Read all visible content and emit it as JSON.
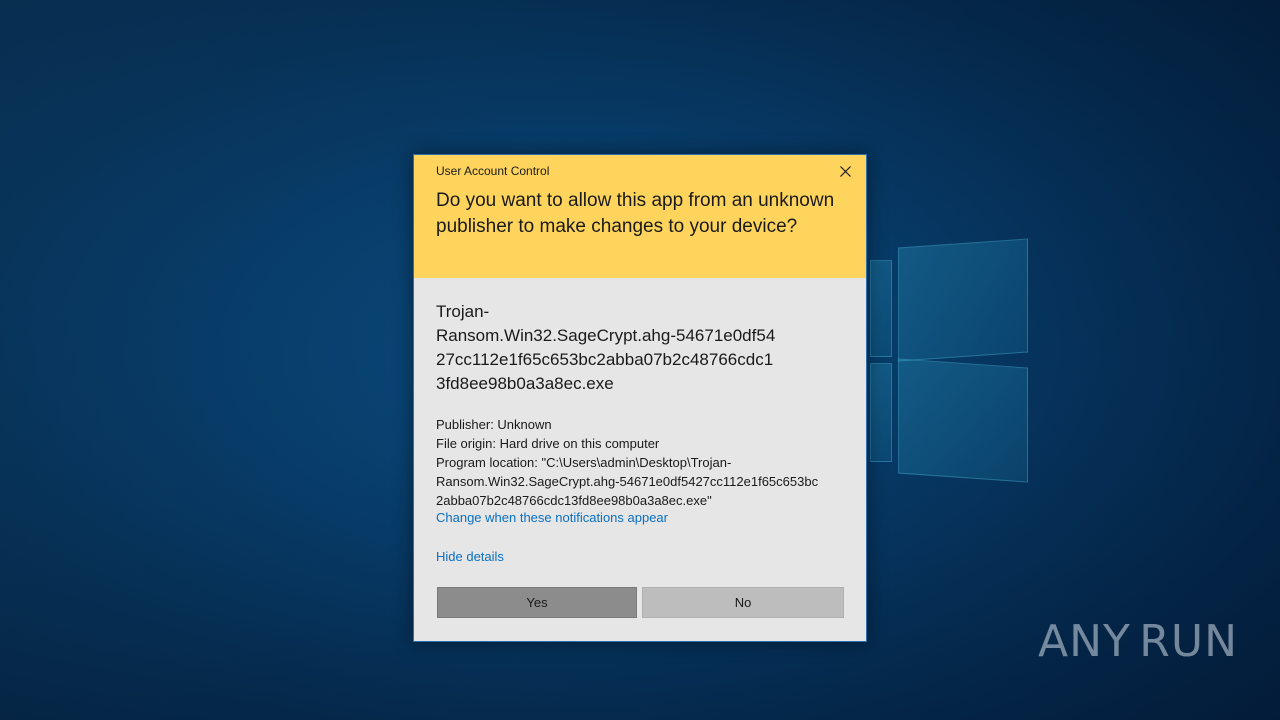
{
  "desktop": {
    "background_color": "#073a66"
  },
  "dialog": {
    "title": "User Account Control",
    "header_color": "#ffd45c",
    "question": "Do you want to allow this app from an unknown publisher to make changes to your device?",
    "app_name": "Trojan-\nRansom.Win32.SageCrypt.ahg-54671e0df54\n27cc112e1f65c653bc2abba07b2c48766cdc1\n3fd8ee98b0a3a8ec.exe",
    "publisher": "Publisher: Unknown",
    "file_origin": "File origin: Hard drive on this computer",
    "program_location": "Program location: \"C:\\Users\\admin\\Desktop\\Trojan-\nRansom.Win32.SageCrypt.ahg-54671e0df5427cc112e1f65c653bc\n2abba07b2c48766cdc13fd8ee98b0a3a8ec.exe\"",
    "change_notifications_link": "Change when these notifications appear",
    "hide_details_link": "Hide details",
    "yes_label": "Yes",
    "no_label": "No",
    "close_icon": "close-icon"
  },
  "watermark": {
    "left_text": "ANY",
    "right_text": "RUN",
    "icon": "play-icon"
  }
}
